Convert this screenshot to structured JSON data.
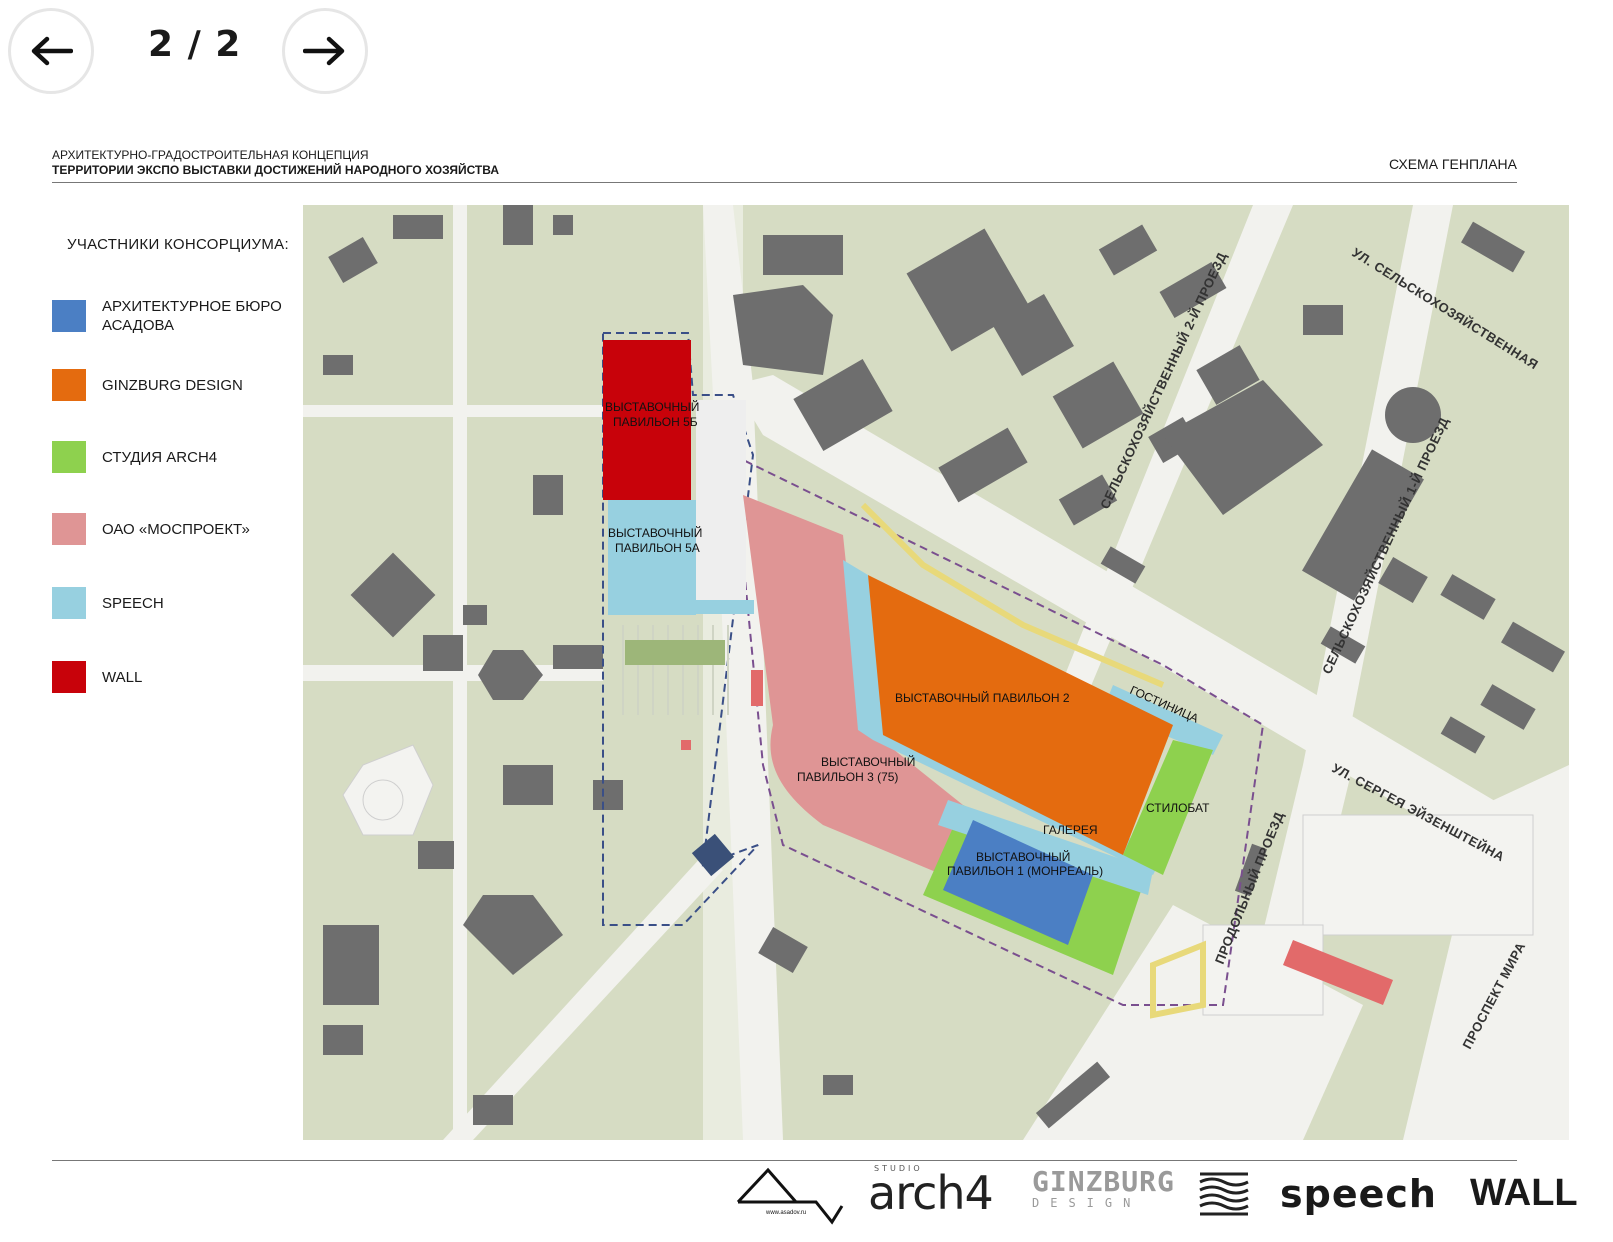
{
  "pager": {
    "text": "2 / 2"
  },
  "header": {
    "line1": "АРХИТЕКТУРНО-ГРАДОСТРОИТЕЛЬНАЯ КОНЦЕПЦИЯ",
    "line2": "ТЕРРИТОРИИ ЭКСПО ВЫСТАВКИ ДОСТИЖЕНИЙ НАРОДНОГО ХОЗЯЙСТВА",
    "right": "СХЕМА ГЕНПЛАНА"
  },
  "legend": {
    "title": "УЧАСТНИКИ КОНСОРЦИУМА:",
    "items": [
      {
        "label": "АРХИТЕКТУРНОЕ БЮРО\nАСАДОВА",
        "color": "#4b7fc4"
      },
      {
        "label": "GINZBURG DESIGN",
        "color": "#e46b0f"
      },
      {
        "label": "СТУДИЯ ARCH4",
        "color": "#8ed14e"
      },
      {
        "label": "ОАО «МОСПРОЕКТ»",
        "color": "#df9595"
      },
      {
        "label": "SPEECH",
        "color": "#97d0e0"
      },
      {
        "label": "WALL",
        "color": "#c8020a"
      }
    ]
  },
  "map_labels": {
    "pav5b_1": "ВЫСТАВОЧНЫЙ",
    "pav5b_2": "ПАВИЛЬОН 5Б",
    "pav5a_1": "ВЫСТАВОЧНЫЙ",
    "pav5a_2": "ПАВИЛЬОН 5А",
    "pav2": "ВЫСТАВОЧНЫЙ ПАВИЛЬОН 2",
    "hotel": "ГОСТИНИЦА",
    "pav3_1": "ВЫСТАВОЧНЫЙ",
    "pav3_2": "ПАВИЛЬОН 3 (75)",
    "stylobate": "СТИЛОБАТ",
    "gallery": "ГАЛЕРЕЯ",
    "pav1_1": "ВЫСТАВОЧНЫЙ",
    "pav1_2": "ПАВИЛЬОН 1 (МОНРЕАЛЬ)"
  },
  "streets": {
    "s1": "УЛ. СЕЛЬСКОХОЗЯЙСТВЕННАЯ",
    "s2": "СЕЛЬСКОХОЗЯЙСТВЕННЫЙ 2-Й ПРОЕЗД",
    "s3": "СЕЛЬСКОХОЗЯЙСТВЕННЫЙ 1-Й ПРОЕЗД",
    "s4": "УЛ. СЕРГЕЯ ЭЙЗЕНШТЕЙНА",
    "s5": "ПРОДОЛЬНЫЙ ПРОЕЗД",
    "s6": "ПРОСПЕКТ МИРА"
  },
  "logos": {
    "asadov_small": "www.asadov.ru",
    "arch4_small": "STUDIO",
    "arch4": "arch4",
    "ginzburg1": "GINZBURG",
    "ginzburg2": "DESIGN",
    "speech": "speech",
    "wall": "WALL"
  },
  "icons": {
    "prev": "arrow-left-icon",
    "next": "arrow-right-icon"
  }
}
